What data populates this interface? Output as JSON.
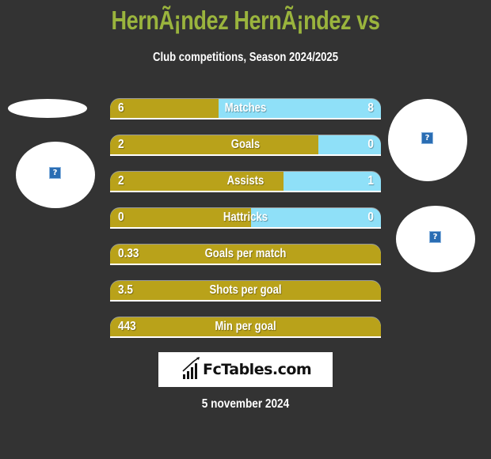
{
  "header": {
    "title": "HernÃ¡ndez HernÃ¡ndez vs",
    "subtitle": "Club competitions, Season 2024/2025"
  },
  "colors": {
    "background": "#333333",
    "title": "#9ab43d",
    "left_bar": "#b9a21a",
    "right_bar": "#8fe0f8"
  },
  "stats": [
    {
      "label": "Matches",
      "left": "6",
      "right": "8",
      "left_share": 0.4
    },
    {
      "label": "Goals",
      "left": "2",
      "right": "0",
      "left_share": 0.77
    },
    {
      "label": "Assists",
      "left": "2",
      "right": "1",
      "left_share": 0.64
    },
    {
      "label": "Hattricks",
      "left": "0",
      "right": "0",
      "left_share": 0.52
    },
    {
      "label": "Goals per match",
      "left": "0.33",
      "right": "",
      "left_share": 1.0
    },
    {
      "label": "Shots per goal",
      "left": "3.5",
      "right": "",
      "left_share": 1.0
    },
    {
      "label": "Min per goal",
      "left": "443",
      "right": "",
      "left_share": 1.0
    }
  ],
  "images": {
    "placeholder_icon": "?"
  },
  "logo": {
    "text": "FcTables.com",
    "icon": "bar-chart-icon"
  },
  "footer": {
    "date": "5 november 2024"
  }
}
